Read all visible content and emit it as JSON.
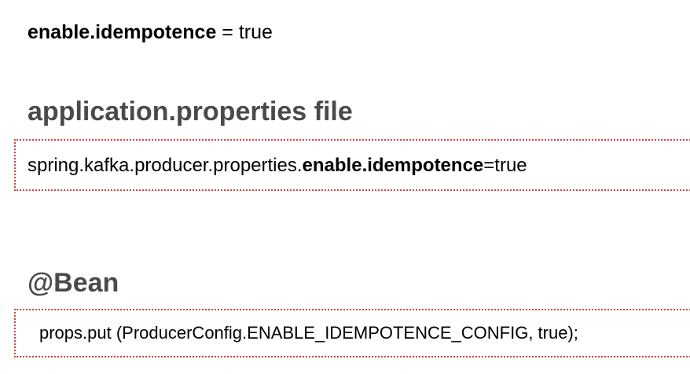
{
  "line1": {
    "key": "enable.idempotence",
    "rest": " = true"
  },
  "section1": {
    "heading": "application.properties file",
    "code_prefix": "spring.kafka.producer.properties.",
    "code_key": "enable.idempotence",
    "code_suffix": "=true"
  },
  "section2": {
    "heading": "@Bean",
    "code": "props.put (ProducerConfig.ENABLE_IDEMPOTENCE_CONFIG, true);"
  },
  "colors": {
    "heading": "#4a4a4a",
    "border": "#c9473f",
    "text": "#000000"
  }
}
